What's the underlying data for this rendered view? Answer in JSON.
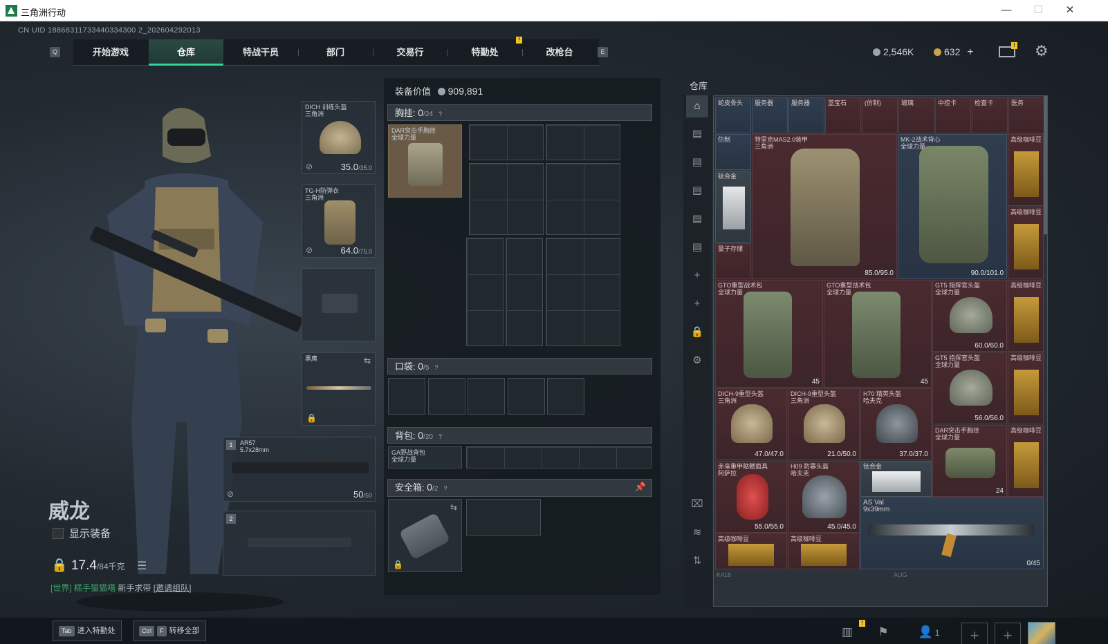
{
  "window": {
    "title": "三角洲行动",
    "minimize": "—",
    "maximize": "☐",
    "close": "✕"
  },
  "uid": "CN UID 18868311733440334300 2_202604292013",
  "nav": {
    "left_key": "Q",
    "right_key": "E",
    "tabs": [
      "开始游戏",
      "仓库",
      "特战干员",
      "部门",
      "交易行",
      "特勤处",
      "改枪台"
    ],
    "active_tab": "仓库",
    "notif": "!"
  },
  "currency": {
    "silver": "2,546K",
    "gold": "632",
    "add": "+"
  },
  "operator": {
    "name": "威龙",
    "show_equipment": "显示装备",
    "weight": "17.4",
    "weight_max": "/84千克",
    "chat_channel": "[世界]",
    "chat_user": "糕手猫猫噶",
    "chat_text": "新手求带",
    "chat_link": "[邀请组队]"
  },
  "equip_slots": {
    "helmet": {
      "name": "DICH 训练头盔",
      "sub": "三角洲",
      "dur": "35.0",
      "dur_max": "/35.0"
    },
    "armor": {
      "name": "TG-H防弹衣",
      "sub": "三角洲",
      "dur": "64.0",
      "dur_max": "/75.0"
    },
    "melee": {
      "name": "黑鹰"
    },
    "primary": {
      "num": "1",
      "name": "AR57",
      "caliber": "5.7x28mm",
      "ammo": "50",
      "ammo_max": "/50"
    },
    "secondary": {
      "num": "2"
    }
  },
  "loadout": {
    "value_label": "装备价值",
    "value": "909,891",
    "chest": {
      "label": "胸挂:",
      "cur": "0",
      "max": "/24",
      "item": "DAR突击手胸挂",
      "item_sub": "全球力量"
    },
    "pocket": {
      "label": "口袋:",
      "cur": "0",
      "max": "/5"
    },
    "backpack": {
      "label": "背包:",
      "cur": "0",
      "max": "/20",
      "item": "GA野战背包",
      "item_sub": "全球力量"
    },
    "safe": {
      "label": "安全箱:",
      "cur": "0",
      "max": "/2"
    }
  },
  "stash": {
    "title": "仓库",
    "top_row": [
      "蛇皮骨头",
      "服务器",
      "服务器",
      "蓝宝石",
      "(仿制)",
      "玻璃",
      "中控卡",
      "检查卡",
      "医务"
    ],
    "items": [
      {
        "name": "仿制",
        "sub": ""
      },
      {
        "name": "钛合金",
        "sub": ""
      },
      {
        "name": "量子存储",
        "sub": ""
      },
      {
        "name": "特里克MAS2.0装甲",
        "sub": "三角洲",
        "dur": "85.0/95.0"
      },
      {
        "name": "MK-2战术背心",
        "sub": "全球力量",
        "dur": "90.0/101.0"
      },
      {
        "name": "高级咖啡豆",
        "sub": ""
      },
      {
        "name": "高级咖啡豆",
        "sub": ""
      },
      {
        "name": "GTO重型战术包",
        "sub": "全球力量",
        "count": "45"
      },
      {
        "name": "GTO重型战术包",
        "sub": "全球力量",
        "count": "45"
      },
      {
        "name": "GT5 指挥官头盔",
        "sub": "全球力量",
        "dur": "60.0/60.0"
      },
      {
        "name": "高级咖啡豆",
        "sub": ""
      },
      {
        "name": "GT5 指挥官头盔",
        "sub": "全球力量",
        "dur": "56.0/56.0"
      },
      {
        "name": "高级咖啡豆",
        "sub": ""
      },
      {
        "name": "DICH-9重型头盔",
        "sub": "三角洲",
        "dur": "47.0/47.0"
      },
      {
        "name": "DICH-9重型头盔",
        "sub": "三角洲",
        "dur": "21.0/50.0"
      },
      {
        "name": "H70 精英头盔",
        "sub": "哈夫克",
        "dur": "37.0/37.0"
      },
      {
        "name": "DAR突击手胸挂",
        "sub": "全球力量",
        "count": "24"
      },
      {
        "name": "高级咖啡豆",
        "sub": ""
      },
      {
        "name": "赤枭重甲骷髅面具",
        "sub": "阿萨拉",
        "dur": "55.0/55.0"
      },
      {
        "name": "H09 防暴头盔",
        "sub": "哈夫克",
        "dur": "45.0/45.0"
      },
      {
        "name": "钛合金",
        "sub": ""
      },
      {
        "name": "AS Val",
        "sub": "9x39mm",
        "dur": "0/45"
      },
      {
        "name": "高级咖啡豆",
        "sub": ""
      },
      {
        "name": "高级咖啡豆",
        "sub": ""
      }
    ],
    "footer_left": "K416",
    "footer_right": "AUG"
  },
  "bottom": {
    "tab_key": "Tab",
    "tab_label": "进入特勤处",
    "ctrl_key": "Ctrl",
    "f_key": "F",
    "transfer_label": "转移全部",
    "squad_count": "1",
    "notif": "!"
  }
}
